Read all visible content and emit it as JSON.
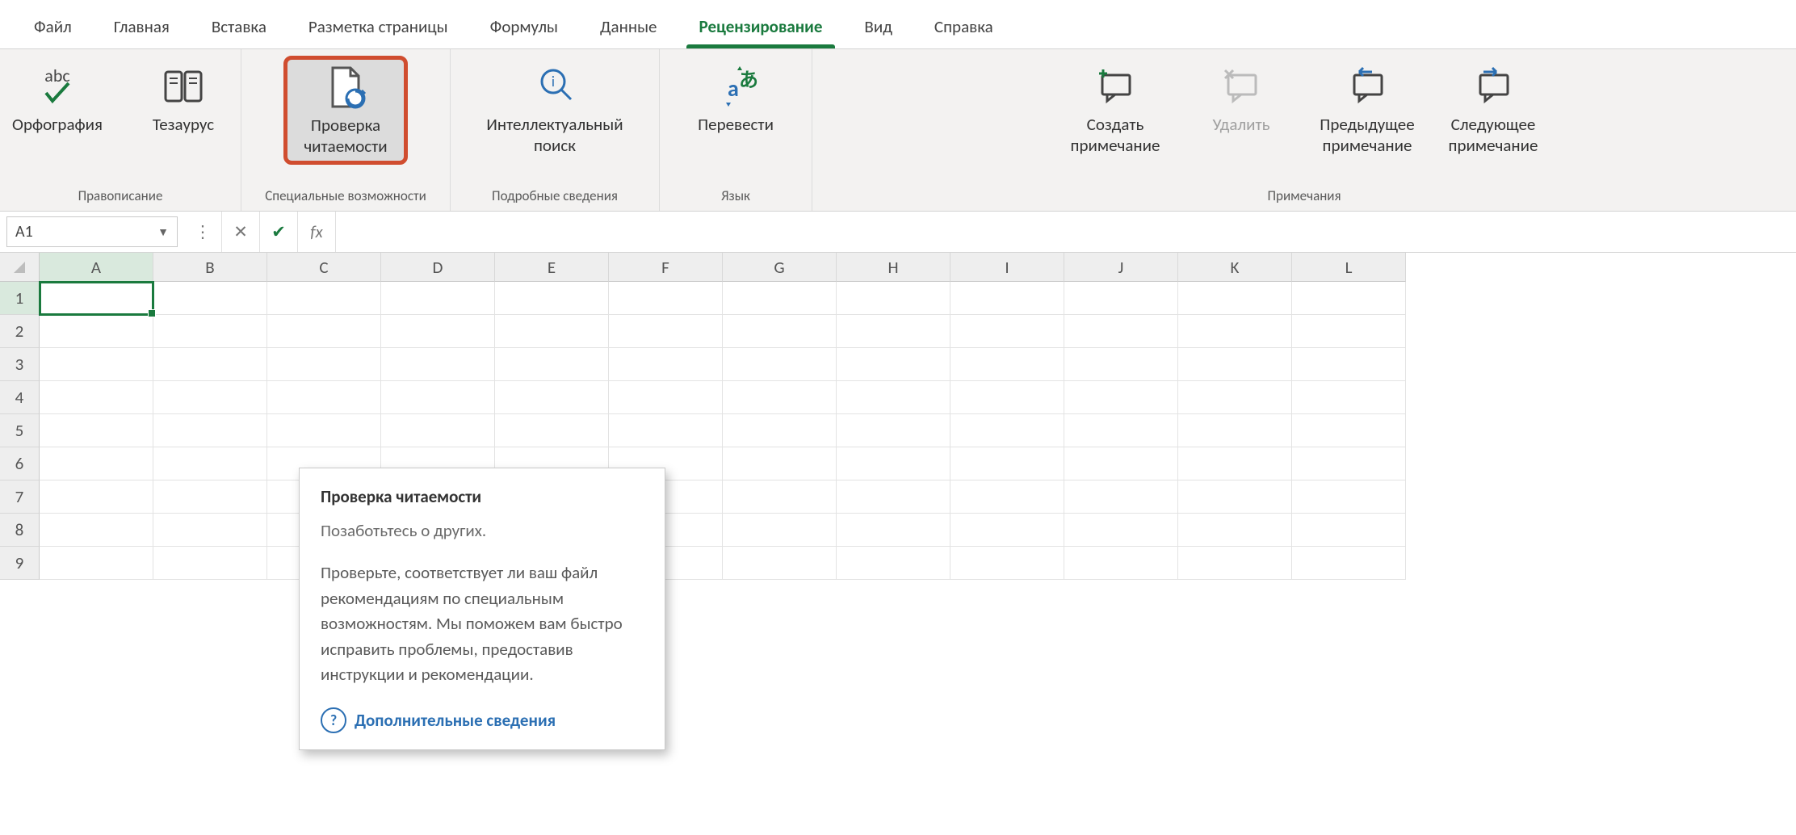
{
  "tabs": {
    "file": "Файл",
    "home": "Главная",
    "insert": "Вставка",
    "pagelayout": "Разметка страницы",
    "formulas": "Формулы",
    "data": "Данные",
    "review": "Рецензирование",
    "view": "Вид",
    "help": "Справка",
    "active": "review"
  },
  "ribbon": {
    "proofing": {
      "spelling": "Орфография",
      "thesaurus": "Тезаурус",
      "group_label": "Правописание",
      "abc_label": "abc"
    },
    "accessibility": {
      "check_line1": "Проверка",
      "check_line2": "читаемости",
      "group_label": "Специальные возможности"
    },
    "insights": {
      "smart_line1": "Интеллектуальный",
      "smart_line2": "поиск",
      "group_label": "Подробные сведения"
    },
    "language": {
      "translate": "Перевести",
      "group_label": "Язык"
    },
    "comments": {
      "new_line1": "Создать",
      "new_line2": "примечание",
      "delete": "Удалить",
      "prev_line1": "Предыдущее",
      "prev_line2": "примечание",
      "next_line1": "Следующее",
      "next_line2": "примечание",
      "group_label": "Примечания"
    }
  },
  "formula_bar": {
    "namebox_value": "A1",
    "fx_label": "fx"
  },
  "grid": {
    "columns": [
      "A",
      "B",
      "C",
      "D",
      "E",
      "F",
      "G",
      "H",
      "I",
      "J",
      "K",
      "L"
    ],
    "rows": [
      "1",
      "2",
      "3",
      "4",
      "5",
      "6",
      "7",
      "8",
      "9"
    ],
    "active_cell": "A1"
  },
  "tooltip": {
    "title": "Проверка читаемости",
    "subtitle": "Позаботьтесь о других.",
    "body": "Проверьте, соответствует ли ваш файл рекомендациям по специальным возможностям. Мы поможем вам быстро исправить проблемы, предоставив инструкции и рекомендации.",
    "link": "Дополнительные сведения",
    "qmark": "?"
  }
}
